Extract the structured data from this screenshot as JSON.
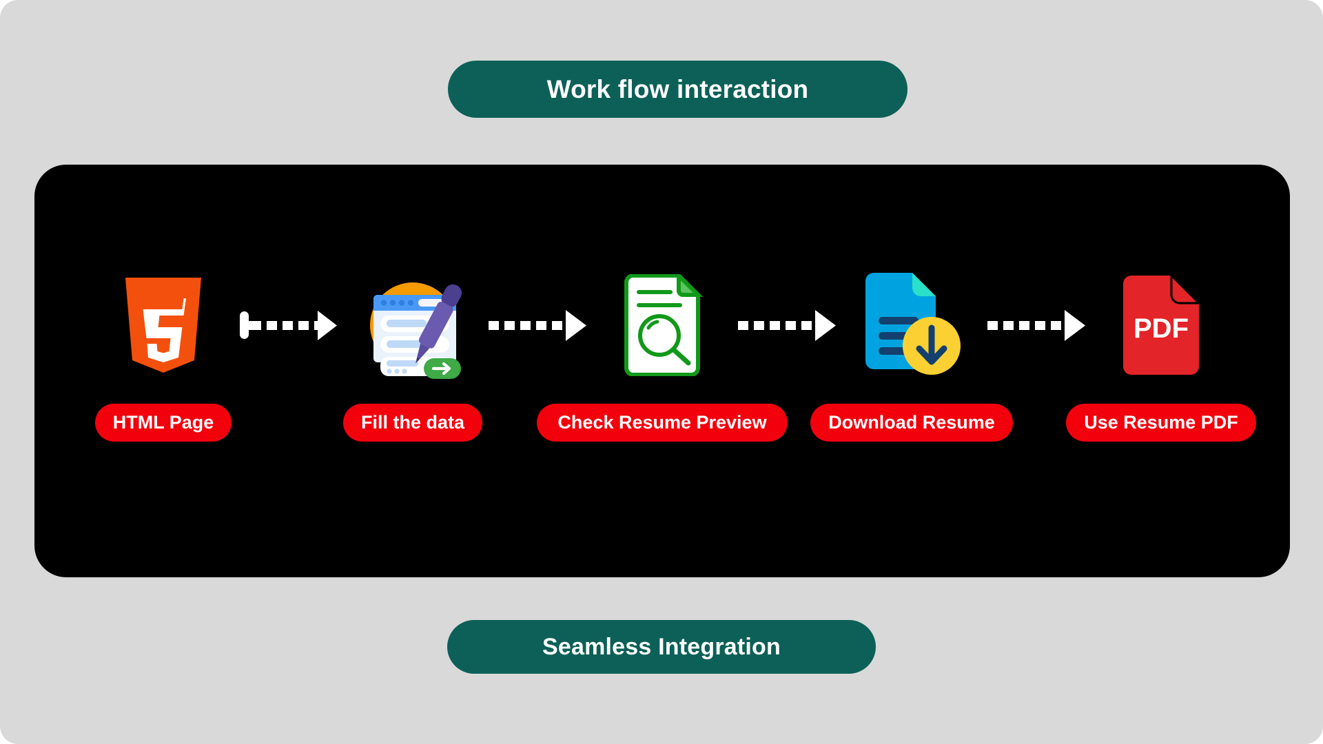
{
  "page": {
    "background_color": "#d9d9d9",
    "panel_color": "#000000"
  },
  "banners": {
    "top": {
      "label": "Work flow interaction",
      "color": "#0c6057",
      "text_color": "#ffffff"
    },
    "bottom": {
      "label": "Seamless Integration",
      "color": "#0c6057",
      "text_color": "#ffffff"
    }
  },
  "workflow": {
    "label_color": "#f3000d",
    "label_text_color": "#ffffff",
    "connector_color": "#ffffff",
    "steps": [
      {
        "label": "HTML Page",
        "icon": "html5-icon"
      },
      {
        "label": "Fill the data",
        "icon": "form-fill-pen-icon"
      },
      {
        "label": "Check Resume Preview",
        "icon": "document-search-icon"
      },
      {
        "label": "Download Resume",
        "icon": "document-download-icon"
      },
      {
        "label": "Use Resume PDF",
        "icon": "pdf-file-icon"
      }
    ],
    "connectors": [
      {
        "style": "dashed-arrow-with-tail"
      },
      {
        "style": "dashed-arrow"
      },
      {
        "style": "dashed-arrow"
      },
      {
        "style": "dashed-arrow"
      }
    ]
  }
}
